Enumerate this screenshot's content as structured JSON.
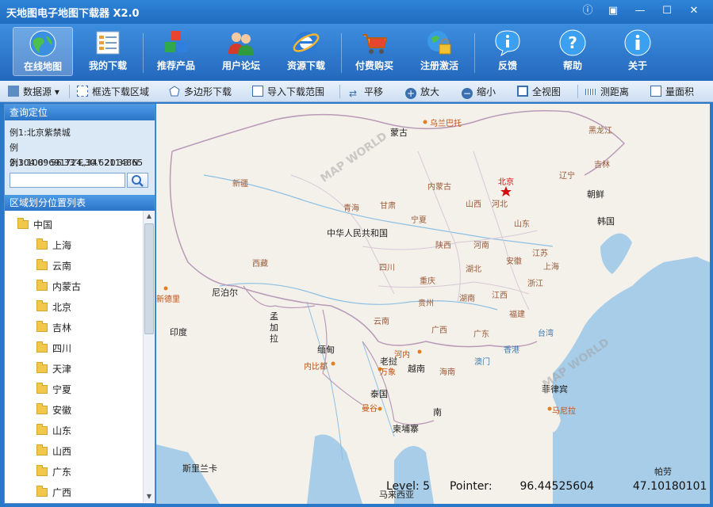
{
  "app": {
    "title": "天地图电子地图下载器 X2.0"
  },
  "window_buttons": [
    "!",
    "▣",
    "—",
    "☐",
    "✕"
  ],
  "toolbar": {
    "items": [
      {
        "label": "在线地图",
        "icon": "globe-icon"
      },
      {
        "label": "我的下载",
        "icon": "download-list-icon"
      },
      {
        "label": "推荐产品",
        "icon": "blocks-icon"
      },
      {
        "label": "用户论坛",
        "icon": "users-icon"
      },
      {
        "label": "资源下载",
        "icon": "ie-icon"
      },
      {
        "label": "付费购买",
        "icon": "cart-icon"
      },
      {
        "label": "注册激活",
        "icon": "lock-globe-icon"
      },
      {
        "label": "反馈",
        "icon": "info-bubble-icon"
      },
      {
        "label": "帮助",
        "icon": "help-icon"
      },
      {
        "label": "关于",
        "icon": "about-icon"
      }
    ]
  },
  "toolbar2": {
    "items": [
      {
        "label": "数据源",
        "icon": "layers-icon"
      },
      {
        "label": "框选下载区域",
        "icon": "select-rect-icon"
      },
      {
        "label": "多边形下载",
        "icon": "polygon-icon"
      },
      {
        "label": "导入下载范围",
        "icon": "import-icon"
      },
      {
        "label": "平移",
        "icon": "pan-icon"
      },
      {
        "label": "放大",
        "icon": "zoom-in-icon"
      },
      {
        "label": "缩小",
        "icon": "zoom-out-icon"
      },
      {
        "label": "全视图",
        "icon": "fullview-icon"
      },
      {
        "label": "测距离",
        "icon": "ruler-icon"
      },
      {
        "label": "量面积",
        "icon": "area-icon"
      }
    ]
  },
  "query": {
    "header": "查询定位",
    "examples": [
      "例1:北京紫禁城",
      "例2:104.09691724,30.62114865",
      "例3:108° 56′33″E,34° 20′33″N"
    ],
    "input_value": ""
  },
  "region": {
    "header": "区域划分位置列表",
    "root": "中国",
    "items": [
      "上海",
      "云南",
      "内蒙古",
      "北京",
      "吉林",
      "四川",
      "天津",
      "宁夏",
      "安徽",
      "山东",
      "山西",
      "广东",
      "广西"
    ]
  },
  "map": {
    "countries": [
      "蒙古",
      "中华人民共和国",
      "朝鲜",
      "韩国",
      "尼泊尔",
      "印度",
      "孟加拉",
      "缅甸",
      "老挝",
      "越南",
      "泰国",
      "柬埔寨",
      "南",
      "菲律宾",
      "斯里兰卡",
      "马来西亚",
      "帕劳"
    ],
    "provinces": [
      "新疆",
      "西藏",
      "青海",
      "甘肃",
      "内蒙古",
      "宁夏",
      "陕西",
      "山西",
      "河北",
      "河南",
      "山东",
      "四川",
      "重庆",
      "湖北",
      "安徽",
      "江苏",
      "上海",
      "浙江",
      "贵州",
      "湖南",
      "江西",
      "福建",
      "云南",
      "广西",
      "广东",
      "海南",
      "黑龙江",
      "吉林",
      "辽宁"
    ],
    "capitals": [
      "乌兰巴托",
      "北京",
      "新德里",
      "内比都",
      "河内",
      "万象",
      "曼谷",
      "马尼拉",
      "澳门",
      "香港",
      "台湾"
    ],
    "seas": [
      "台湾"
    ],
    "watermarks": [
      "MAP WORLD"
    ]
  },
  "status": {
    "level_label": "Level: 5",
    "pointer_label": "Pointer:",
    "lon": "96.44525604",
    "lat": "47.10180101"
  }
}
